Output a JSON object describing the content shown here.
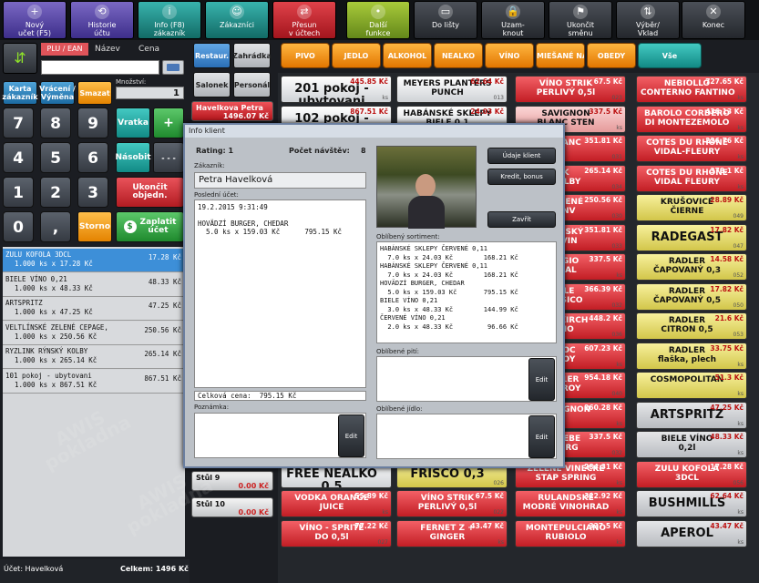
{
  "toolbar": [
    {
      "label": "Nový\nučet (F5)",
      "icon": "new-account-icon",
      "color": "purple"
    },
    {
      "label": "Historie\núčtu",
      "icon": "history-icon",
      "color": "purple"
    },
    {
      "label": "Info (F8)\nzákazník",
      "icon": "customer-info-icon",
      "color": "teal"
    },
    {
      "label": "Zákazníci",
      "icon": "customers-icon",
      "color": "teal"
    },
    {
      "label": "Přesun\nv účtech",
      "icon": "transfer-icon",
      "color": "red"
    },
    {
      "label": "Další\nfunkce",
      "icon": "more-functions-icon",
      "color": "green"
    },
    {
      "label": "Do lišty",
      "icon": "minimize-icon",
      "color": "dark"
    },
    {
      "label": "Uzam-\nknout",
      "icon": "lock-icon",
      "color": "dark"
    },
    {
      "label": "Ukončit\nsměnu",
      "icon": "end-shift-icon",
      "color": "dark"
    },
    {
      "label": "Výběr/\nVklad",
      "icon": "withdraw-deposit-icon",
      "color": "dark"
    },
    {
      "label": "Konec",
      "icon": "close-icon",
      "color": "dark"
    }
  ],
  "search": {
    "tabs": [
      "PLU / EAN",
      "Název",
      "Cena"
    ],
    "quantity_label": "Množství:",
    "quantity_value": "1"
  },
  "keypad": {
    "card": "Karta\nzákazník",
    "return": "Vrácení /\nVýměna",
    "delete": "Smazat",
    "return2": "Vratka",
    "plus": "+",
    "minus": "-",
    "multiply": "Násobit",
    "dots": "- - -",
    "finish": "Ukončit\nobjedn.",
    "storno": "Storno",
    "pay": "Zaplatit\núčet",
    "digits": [
      "7",
      "8",
      "9",
      "4",
      "5",
      "6",
      "1",
      "2",
      "3",
      "0",
      ","
    ]
  },
  "cart": [
    {
      "name": "ZULU KOFOLA 3DCL",
      "line": "1.000 ks x 17.28 Kč",
      "price": "17.28 Kč",
      "selected": true
    },
    {
      "name": "BIELE VÍNO 0,21",
      "line": "1.000 ks x 48.33 Kč",
      "price": "48.33 Kč"
    },
    {
      "name": "ARTSPRITZ",
      "line": "1.000 ks x 47.25 Kč",
      "price": "47.25 Kč"
    },
    {
      "name": "VELTLÍNSKÉ ZELENÉ CEPAGE,",
      "line": "1.000 ks x 250.56 Kč",
      "price": "250.56 Kč"
    },
    {
      "name": "RYZLINK RÝNSKÝ KOLBY",
      "line": "1.000 ks x 265.14 Kč",
      "price": "265.14 Kč"
    },
    {
      "name": "101 pokoj - ubytovani",
      "line": "1.000 ks x 867.51 Kč",
      "price": "867.51 Kč"
    }
  ],
  "footer": {
    "account": "Účet:  Havelková",
    "total": "Celkem: 1496 Kč"
  },
  "areas": [
    "Restaur.",
    "Zahrádka",
    "Salonek",
    "Personál"
  ],
  "tables": [
    {
      "name": "Havelkova Petra",
      "amount": "1496.07 Kč",
      "active": true
    },
    {
      "name": "Stůl 9",
      "amount": "0.00 Kč"
    },
    {
      "name": "Stůl 10",
      "amount": "0.00 Kč"
    }
  ],
  "categories": [
    "PIVO",
    "JEDLO",
    "ALKOHOL",
    "NEALKO",
    "VÍNO",
    "MIEŠANÉ NÁPOJ",
    "OBEDY",
    "Vše"
  ],
  "products": [
    [
      {
        "name": "201 pokoj -\nubytovani",
        "price": "445.85 Kč",
        "code": "ks",
        "style": "white",
        "big": true
      },
      {
        "name": "102 pokoj -",
        "price": "867.51 Kč",
        "code": "ks",
        "style": "white",
        "big": true
      },
      {
        "name": "",
        "price": "",
        "code": "",
        "style": "hidden"
      },
      {
        "name": "",
        "price": "",
        "code": "",
        "style": "hidden"
      },
      {
        "name": "",
        "price": "",
        "code": "",
        "style": "hidden"
      },
      {
        "name": "",
        "price": "",
        "code": "",
        "style": "hidden"
      },
      {
        "name": "",
        "price": "",
        "code": "",
        "style": "hidden"
      },
      {
        "name": "",
        "price": "",
        "code": "",
        "style": "hidden"
      },
      {
        "name": "",
        "price": "",
        "code": "",
        "style": "hidden"
      },
      {
        "name": "",
        "price": "",
        "code": "",
        "style": "hidden"
      },
      {
        "name": "",
        "price": "",
        "code": "",
        "style": "hidden"
      },
      {
        "name": "",
        "price": "",
        "code": "",
        "style": "hidden"
      },
      {
        "name": "",
        "price": "",
        "code": "",
        "style": "hidden"
      },
      {
        "name": "FREE NEALKO\n0.5",
        "price": "",
        "code": "",
        "style": "white",
        "big": true
      },
      {
        "name": "VODKA ORANGE\nJUICE",
        "price": "55.89 Kč",
        "code": "ks",
        "style": "red"
      },
      {
        "name": "VÍNO - SPRITE\nDO 0,5l",
        "price": "77.22 Kč",
        "code": "027",
        "style": "red"
      }
    ],
    [
      {
        "name": "MEYERS PLANTERS\nPUNCH",
        "price": "62.64 Kč",
        "code": "013",
        "style": "white"
      },
      {
        "name": "HABÁNSKÉ SKLEPY\nBIELE 0,1",
        "price": "24.03 Kč",
        "code": "015",
        "style": "white"
      },
      {
        "name": "",
        "price": "",
        "code": "",
        "style": "hidden"
      },
      {
        "name": "",
        "price": "",
        "code": "",
        "style": "hidden"
      },
      {
        "name": "",
        "price": "",
        "code": "",
        "style": "hidden"
      },
      {
        "name": "",
        "price": "",
        "code": "",
        "style": "hidden"
      },
      {
        "name": "",
        "price": "",
        "code": "",
        "style": "hidden"
      },
      {
        "name": "",
        "price": "",
        "code": "",
        "style": "hidden"
      },
      {
        "name": "",
        "price": "",
        "code": "",
        "style": "hidden"
      },
      {
        "name": "",
        "price": "",
        "code": "",
        "style": "hidden"
      },
      {
        "name": "",
        "price": "",
        "code": "",
        "style": "hidden"
      },
      {
        "name": "",
        "price": "",
        "code": "",
        "style": "hidden"
      },
      {
        "name": "",
        "price": "",
        "code": "",
        "style": "hidden"
      },
      {
        "name": "FRISCO 0,3",
        "price": "",
        "code": "026",
        "style": "yellow",
        "big": true
      },
      {
        "name": "VÍNO STRIK\nPERLIVÝ 0,5l",
        "price": "67.5 Kč",
        "code": "022",
        "style": "red"
      },
      {
        "name": "FERNET Z +\nGINGER",
        "price": "43.47 Kč",
        "code": "ks",
        "style": "red"
      }
    ],
    [
      {
        "name": "VÍNO STRIK\nPERLIVÝ 0,5l",
        "price": "67.5 Kč",
        "code": "023",
        "style": "red"
      },
      {
        "name": "SAVIGNON\nBLANC STEN",
        "price": "337.5 Kč",
        "code": "ks",
        "style": "pink"
      },
      {
        "name": "BLANC",
        "price": "351.81 Kč",
        "code": "031",
        "style": "red"
      },
      {
        "name": "K\nKOLBY",
        "price": "265.14 Kč",
        "code": "034",
        "style": "red"
      },
      {
        "name": "ZELENÉ\n, NV",
        "price": "250.56 Kč",
        "code": "030",
        "style": "red"
      },
      {
        "name": "LAŠSKÝ\nDVIN",
        "price": "351.81 Kč",
        "code": "033",
        "style": "red"
      },
      {
        "name": "RIGIO\nINAL",
        "price": "337.5 Kč",
        "code": "ks",
        "style": "red"
      },
      {
        "name": "ALE\nASSICO",
        "price": "366.39 Kč",
        "code": "032",
        "style": "red"
      },
      {
        "name": "ALTKIRCH\nZIO",
        "price": "448.2 Kč",
        "code": "036",
        "style": "red"
      },
      {
        "name": "AOC\nROY",
        "price": "607.23 Kč",
        "code": "ks",
        "style": "red"
      },
      {
        "name": "S 1ER\nFFROY",
        "price": "954.18 Kč",
        "code": "040",
        "style": "red"
      },
      {
        "name": "AUVIGNON",
        "price": "260.28 Kč",
        "code": "ks",
        "style": "red"
      },
      {
        "name": "TREBE\nBERG",
        "price": "337.5 Kč",
        "code": "032",
        "style": "red"
      },
      {
        "name": "ZELENÉ VINECKE\nSTAP SPRING",
        "price": "284.31 Kč",
        "code": "ks",
        "style": "red"
      },
      {
        "name": "RULANDSKÉ\nMODRÉ VINOHRAD",
        "price": "322.92 Kč",
        "code": "ks",
        "style": "red"
      },
      {
        "name": "MONTEPULCIANO\nRUBIOLO",
        "price": "337.5 Kč",
        "code": "ks",
        "style": "red"
      }
    ],
    [
      {
        "name": "NEBIOLLO\nCONTERNO FANTINO",
        "price": "727.65 Kč",
        "code": "ks",
        "style": "red"
      },
      {
        "name": "BAROLO CORDERO\nDI MONTEZEMOLO",
        "price": "436.13 Kč",
        "code": "ks",
        "style": "red"
      },
      {
        "name": "COTES DU RHONE\nVIDAL-FLEURY",
        "price": "226.76 Kč",
        "code": "ks",
        "style": "red"
      },
      {
        "name": "COTES DU RHONE\nVIDAL FLEURY",
        "price": "378.1 Kč",
        "code": "ks",
        "style": "red"
      },
      {
        "name": "KRUŠOVICE\nČIERNE",
        "price": "28.89 Kč",
        "code": "049",
        "style": "yellow"
      },
      {
        "name": "RADEGAST",
        "price": "17.82 Kč",
        "code": "047",
        "style": "yellow",
        "big": true
      },
      {
        "name": "RADLER\nČAPOVANÝ 0,3",
        "price": "14.58 Kč",
        "code": "052",
        "style": "yellow"
      },
      {
        "name": "RADLER\nČAPOVANÝ 0,5",
        "price": "17.82 Kč",
        "code": "050",
        "style": "yellow"
      },
      {
        "name": "RADLER\nCITRON 0,5",
        "price": "21.6 Kč",
        "code": "053",
        "style": "yellow"
      },
      {
        "name": "RADLER\nflaška, plech",
        "price": "33.75 Kč",
        "code": "ks",
        "style": "yellow"
      },
      {
        "name": "COSMOPOLITAN",
        "price": "51.3 Kč",
        "code": "ks",
        "style": "yellow"
      },
      {
        "name": "ARTSPRITZ",
        "price": "47.25 Kč",
        "code": "ks",
        "style": "grey",
        "big": true
      },
      {
        "name": "BIELE VÍNO\n0,2l",
        "price": "48.33 Kč",
        "code": "ks",
        "style": "grey"
      },
      {
        "name": "ZULU KOFOLA\n3DCL",
        "price": "17.28 Kč",
        "code": "056",
        "style": "red"
      },
      {
        "name": "BUSHMILLS",
        "price": "62.64 Kč",
        "code": "ks",
        "style": "grey",
        "big": true
      },
      {
        "name": "APEROL",
        "price": "43.47 Kč",
        "code": "ks",
        "style": "grey",
        "big": true
      }
    ]
  ],
  "dialog": {
    "title": "Info klient",
    "rating": "Rating: 1",
    "visits_label": "Počet návštěv:",
    "visits": "8",
    "customer_label": "Zákazník:",
    "customer": "Petra Havelková",
    "last_account_label": "Poslední účet:",
    "last_account": "19.2.2015 9:31:49\n\nHOVÄDZÍ BURGER, CHEDAR\n  5.0 ks x 159.03 Kč      795.15 Kč",
    "total": "Celková cena:  795.15 Kč",
    "note_label": "Poznámka:",
    "edit": "Edit",
    "customer_data": "Údaje klient",
    "credit": "Kredit, bonus",
    "close": "Zavřít",
    "fav_label": "Oblíbený sortiment:",
    "fav": "HABÁNSKÉ SKLEPY ČERVENÉ 0,11\n  7.0 ks x 24.03 Kč        168.21 Kč\nHABÁNSKÉ SKLEPY ČERVENÉ 0,11\n  7.0 ks x 24.03 Kč        168.21 Kč\nHOVÄDZÍ BURGER, CHEDAR\n  5.0 ks x 159.03 Kč       795.15 Kč\nBIELE VÍNO 0,21\n  3.0 ks x 48.33 Kč        144.99 Kč\nČERVENÉ VÍNO 0,21\n  2.0 ks x 48.33 Kč         96.66 Kč",
    "fav_drinks_label": "Oblíbené pití:",
    "fav_food_label": "Oblíbené jídlo:"
  },
  "watermark": "AWIS\npokladna"
}
